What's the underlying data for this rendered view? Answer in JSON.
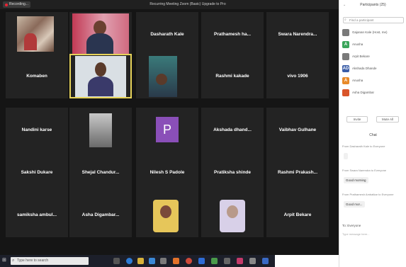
{
  "window": {
    "recording_label": "Recording...",
    "title": "Recurring Meeting Zoom (Basic) Upgrade to Pro"
  },
  "gallery": {
    "tiles": [
      {
        "name": "",
        "video": true
      },
      {
        "name": "",
        "video": true
      },
      {
        "name": "Dasharath Kale",
        "video": false
      },
      {
        "name": "Prathamesh  ha...",
        "video": false
      },
      {
        "name": "Swara  Narendra...",
        "video": false
      },
      {
        "name": "Komaben",
        "video": false
      },
      {
        "name": "",
        "video": true,
        "active_speaker": true
      },
      {
        "name": "",
        "video": true
      },
      {
        "name": "Rashmi kakade",
        "video": false
      },
      {
        "name": "vivo 1906",
        "video": false
      },
      {
        "name": "Nandini karse",
        "video": false
      },
      {
        "name": "",
        "video": true
      },
      {
        "name": "",
        "avatar_letter": "P"
      },
      {
        "name": "Akshada  dhand...",
        "video": false
      },
      {
        "name": "Vaibhav  Gulhane",
        "video": false
      },
      {
        "name": "Sakshi Dukare",
        "video": false
      },
      {
        "name": "Shejal  Chandur...",
        "video": false
      },
      {
        "name": "Nilesh S Padole",
        "video": false
      },
      {
        "name": "Pratiksha shinde",
        "video": false
      },
      {
        "name": "Rashmi  Prakash...",
        "video": false
      },
      {
        "name": "samiksha  ambul...",
        "video": false
      },
      {
        "name": "Asha  Digambar...",
        "video": false
      },
      {
        "name": "",
        "video": true
      },
      {
        "name": "",
        "video": true
      },
      {
        "name": "Arpit Bekare",
        "video": false
      }
    ]
  },
  "taskbar": {
    "search_placeholder": "Type here to search"
  },
  "panel": {
    "title": "Participants (25)",
    "find_placeholder": "Find a participant",
    "participants": [
      {
        "initial": "",
        "name": "Gajanan Kale (Host, me)",
        "color": "#7a7a7a"
      },
      {
        "initial": "A",
        "name": "Anusha",
        "color": "#3aa55a"
      },
      {
        "initial": "",
        "name": "Arpit Bekare",
        "color": "#7a7a7a"
      },
      {
        "initial": "AD",
        "name": "Akshada Dhande",
        "color": "#3b5ea8"
      },
      {
        "initial": "A",
        "name": "Anusha",
        "color": "#e88a2a"
      },
      {
        "initial": "",
        "name": "Asha Digambar",
        "color": "#d9552a"
      }
    ],
    "invite_label": "Invite",
    "mute_all_label": "Mute All",
    "chat_title": "Chat",
    "chat": [
      {
        "meta": "From Dasharath Kale to Everyone",
        "text": ""
      },
      {
        "meta": "From Swara Narendra to Everyone",
        "text": "Good morning"
      },
      {
        "meta": "From Prathamesh Ambatkar to Everyone",
        "text": "Good mor..."
      }
    ],
    "to_label": "To: Everyone",
    "type_placeholder": "Type message here..."
  }
}
